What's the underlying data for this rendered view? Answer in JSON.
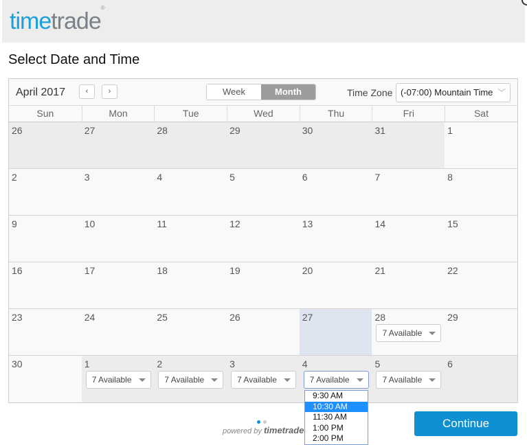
{
  "header": {
    "logo_part1": "time",
    "logo_part2": "trade",
    "logo_mark": "®"
  },
  "page_title": "Select Date and Time",
  "toolbar": {
    "month_label": "April 2017",
    "prev_icon": "‹",
    "next_icon": "›",
    "view_week": "Week",
    "view_month": "Month",
    "timezone_label": "Time Zone",
    "timezone_value": "(-07:00) Mountain Time",
    "timezone_chevron": "﹀"
  },
  "calendar": {
    "days_of_week": [
      "Sun",
      "Mon",
      "Tue",
      "Wed",
      "Thu",
      "Fri",
      "Sat"
    ],
    "weeks": [
      [
        {
          "d": "26",
          "out": true
        },
        {
          "d": "27",
          "out": true
        },
        {
          "d": "28",
          "out": true
        },
        {
          "d": "29",
          "out": true
        },
        {
          "d": "30",
          "out": true
        },
        {
          "d": "31",
          "out": true
        },
        {
          "d": "1"
        }
      ],
      [
        {
          "d": "2"
        },
        {
          "d": "3"
        },
        {
          "d": "4"
        },
        {
          "d": "5"
        },
        {
          "d": "6"
        },
        {
          "d": "7"
        },
        {
          "d": "8"
        }
      ],
      [
        {
          "d": "9"
        },
        {
          "d": "10"
        },
        {
          "d": "11"
        },
        {
          "d": "12"
        },
        {
          "d": "13"
        },
        {
          "d": "14"
        },
        {
          "d": "15"
        }
      ],
      [
        {
          "d": "16"
        },
        {
          "d": "17"
        },
        {
          "d": "18"
        },
        {
          "d": "19"
        },
        {
          "d": "20"
        },
        {
          "d": "21"
        },
        {
          "d": "22"
        }
      ],
      [
        {
          "d": "23"
        },
        {
          "d": "24"
        },
        {
          "d": "25"
        },
        {
          "d": "26"
        },
        {
          "d": "27",
          "today": true
        },
        {
          "d": "28",
          "avail": "7 Available"
        },
        {
          "d": "29"
        }
      ],
      [
        {
          "d": "30"
        },
        {
          "d": "1",
          "out": true,
          "avail": "7 Available"
        },
        {
          "d": "2",
          "out": true,
          "avail": "7 Available"
        },
        {
          "d": "3",
          "out": true,
          "avail": "7 Available"
        },
        {
          "d": "4",
          "out": true,
          "avail": "7 Available",
          "open": true
        },
        {
          "d": "5",
          "out": true,
          "avail": "7 Available"
        },
        {
          "d": "6",
          "out": true
        }
      ]
    ]
  },
  "time_dropdown": {
    "options": [
      "9:30 AM",
      "10:30 AM",
      "11:30 AM",
      "1:00 PM",
      "2:00 PM"
    ],
    "selected": "10:30 AM"
  },
  "footer": {
    "powered_by": "powered by",
    "powered_brand": "timetrade",
    "continue_label": "Continue",
    "page_dots": [
      {
        "active": true
      },
      {
        "active": false
      }
    ]
  },
  "colors": {
    "brand_blue": "#1aa0d8",
    "button": "#0d8fd1",
    "selected_option": "#1e90ff",
    "today_bg": "#dfe4f1"
  }
}
